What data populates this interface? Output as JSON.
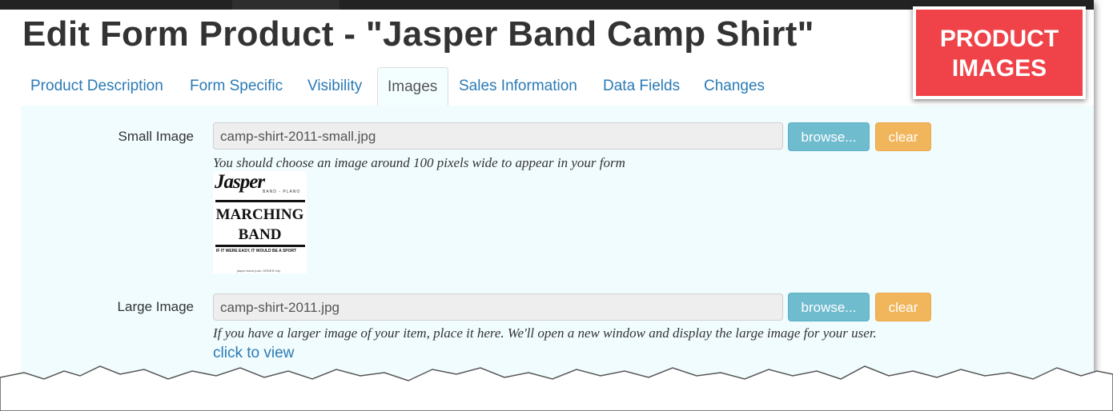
{
  "page": {
    "title": "Edit Form Product - \"Jasper Band Camp Shirt\""
  },
  "badge": {
    "line1": "PRODUCT",
    "line2": "IMAGES"
  },
  "tabs": [
    {
      "label": "Product Description",
      "active": false
    },
    {
      "label": "Form Specific",
      "active": false
    },
    {
      "label": "Visibility",
      "active": false
    },
    {
      "label": "Images",
      "active": true
    },
    {
      "label": "Sales Information",
      "active": false
    },
    {
      "label": "Data Fields",
      "active": false
    },
    {
      "label": "Changes",
      "active": false
    }
  ],
  "small_image": {
    "label": "Small Image",
    "value": "camp-shirt-2011-small.jpg",
    "browse_label": "browse...",
    "clear_label": "clear",
    "help": "You should choose an image around 100 pixels wide to appear in your form",
    "preview": {
      "logo_text": "Jasper",
      "sub_text": "BAND - PLANO",
      "line1": "MARCHING",
      "line2": "BAND",
      "tagline": "IF IT WERE EASY, IT WOULD BE A SPORT",
      "fine_print": "jasper band (unk. ORDER ink)"
    }
  },
  "large_image": {
    "label": "Large Image",
    "value": "camp-shirt-2011.jpg",
    "browse_label": "browse...",
    "clear_label": "clear",
    "help": "If you have a larger image of your item, place it here. We'll open a new window and display the large image for your user.",
    "link_label": "click to view"
  },
  "colors": {
    "accent_link": "#2a7ab5",
    "panel_bg": "#f1fcff",
    "browse_btn": "#6fbccf",
    "clear_btn": "#f1b65b",
    "badge_bg": "#ef4349"
  }
}
